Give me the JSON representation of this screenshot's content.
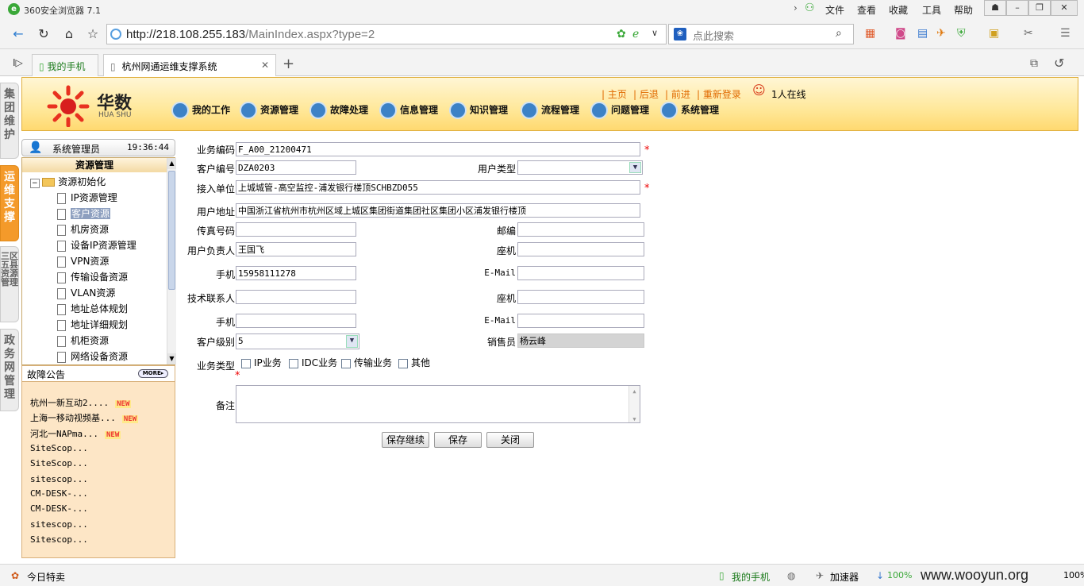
{
  "browser": {
    "title": "360安全浏览器 7.1",
    "menu": [
      "文件",
      "查看",
      "收藏",
      "工具",
      "帮助"
    ],
    "address_host": "http://218.108.255.183",
    "address_path": "/MainIndex.aspx?type=2",
    "search_placeholder": "点此搜索",
    "tabs": [
      {
        "label": "我的手机"
      },
      {
        "label": "杭州网通运维支撑系统"
      }
    ]
  },
  "sidetabs": [
    "集团维护",
    "运维支撑",
    "三区五县资源管理",
    "政务网管理"
  ],
  "header": {
    "brand": "华数",
    "brand_en": "HUA SHU",
    "links": [
      "主页",
      "后退",
      "前进",
      "重新登录"
    ],
    "online": "1人在线",
    "nav": [
      "我的工作",
      "资源管理",
      "故障处理",
      "信息管理",
      "知识管理",
      "流程管理",
      "问题管理",
      "系统管理"
    ]
  },
  "user": {
    "name": "系统管理员",
    "time": "19:36:44"
  },
  "tree": {
    "title": "资源管理",
    "root": "资源初始化",
    "items": [
      "IP资源管理",
      "客户资源",
      "机房资源",
      "设备IP资源管理",
      "VPN资源",
      "传输设备资源",
      "VLAN资源",
      "地址总体规划",
      "地址详细规划",
      "机柜资源",
      "网络设备资源"
    ],
    "selected": "客户资源"
  },
  "notice": {
    "title": "故障公告",
    "more": "MORE",
    "items": [
      {
        "text": "杭州一新互动2....",
        "new": true
      },
      {
        "text": "上海一移动视频基...",
        "new": true
      },
      {
        "text": "河北一NAPma...",
        "new": true
      },
      {
        "text": "SiteScop...",
        "new": false
      },
      {
        "text": "SiteScop...",
        "new": false
      },
      {
        "text": "sitescop...",
        "new": false
      },
      {
        "text": "CM-DESK-...",
        "new": false
      },
      {
        "text": "CM-DESK-...",
        "new": false
      },
      {
        "text": "sitescop...",
        "new": false
      },
      {
        "text": "Sitescop...",
        "new": false
      }
    ],
    "new_label": "NEW"
  },
  "form": {
    "biz_code_label": "业务编码",
    "biz_code": "F_A00_21200471",
    "cust_no_label": "客户编号",
    "cust_no": "DZA0203",
    "user_type_label": "用户类型",
    "user_type": "",
    "access_unit_label": "接入单位",
    "access_unit": "上城城管-高空监控-浦发银行楼顶SCHBZD055",
    "user_addr_label": "用户地址",
    "user_addr": "中国浙江省杭州市杭州区域上城区集团街道集团社区集团小区浦发银行楼顶",
    "fax_label": "传真号码",
    "fax": "",
    "zip_label": "邮编",
    "zip": "",
    "owner_label": "用户负责人",
    "owner": "王国飞",
    "landline_label": "座机",
    "landline": "",
    "mobile_label": "手机",
    "mobile": "15958111278",
    "email_label": "E-Mail",
    "email": "",
    "tech_label": "技术联系人",
    "tech": "",
    "tech_landline_label": "座机",
    "tech_landline": "",
    "tech_mobile_label": "手机",
    "tech_mobile": "",
    "tech_email_label": "E-Mail",
    "tech_email": "",
    "level_label": "客户级别",
    "level": "5",
    "sales_label": "销售员",
    "sales": "杨云峰",
    "service_type_label": "业务类型",
    "services": [
      "IP业务",
      "IDC业务",
      "传输业务",
      "其他"
    ],
    "remark_label": "备注",
    "remark": "",
    "buttons": [
      "保存继续",
      "保存",
      "关闭"
    ]
  },
  "statusbar": {
    "left": "今日特卖",
    "phone": "我的手机",
    "accel": "加速器",
    "speed": "100%",
    "zoom": "100%",
    "watermark": "www.wooyun.org"
  }
}
